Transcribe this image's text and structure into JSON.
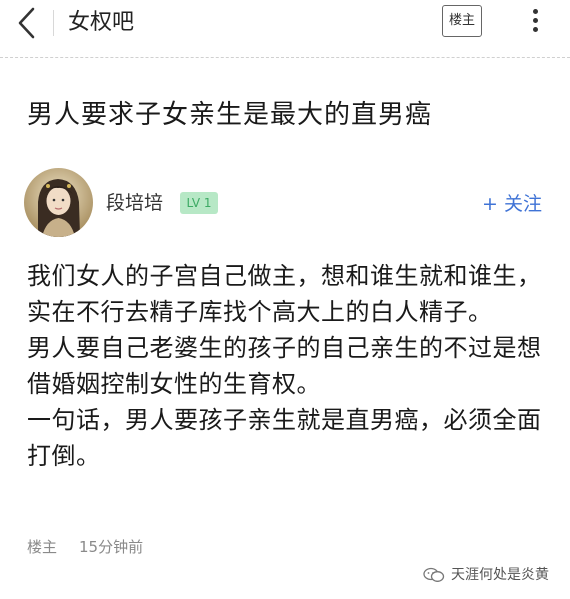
{
  "header": {
    "forum_name": "女权吧",
    "op_only_label": "楼主"
  },
  "post": {
    "title": "男人要求子女亲生是最大的直男癌",
    "author": {
      "name": "段培培",
      "level": "LV 1"
    },
    "follow_label": "+ 关注",
    "paragraphs": [
      "我们女人的子宫自己做主，想和谁生就和谁生，实在不行去精子库找个高大上的白人精子。",
      "男人要自己老婆生的孩子的自己亲生的不过是想借婚姻控制女性的生育权。",
      "一句话，男人要孩子亲生就是直男癌，必须全面打倒。"
    ],
    "footer": {
      "author_tag": "楼主",
      "time": "15分钟前"
    }
  },
  "watermark": {
    "text": "天涯何处是炎黄"
  },
  "colors": {
    "accent": "#3f73d6",
    "level_bg": "#b7e8c6",
    "level_text": "#3daa64"
  }
}
